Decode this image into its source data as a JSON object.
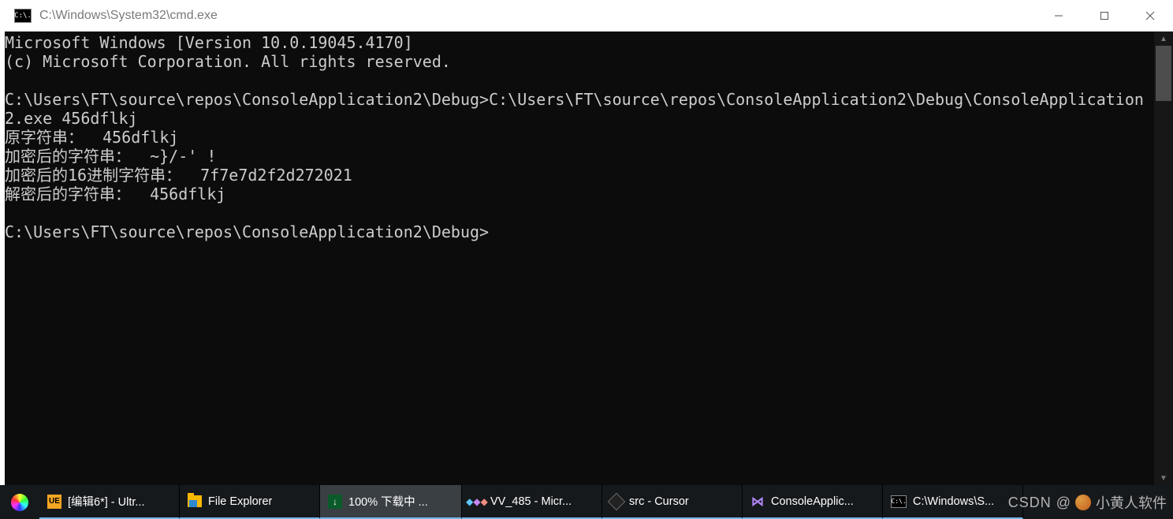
{
  "window": {
    "title": "C:\\Windows\\System32\\cmd.exe",
    "icon_label": "C:\\."
  },
  "console": {
    "lines": [
      "Microsoft Windows [Version 10.0.19045.4170]",
      "(c) Microsoft Corporation. All rights reserved.",
      "",
      "C:\\Users\\FT\\source\\repos\\ConsoleApplication2\\Debug>C:\\Users\\FT\\source\\repos\\ConsoleApplication2\\Debug\\ConsoleApplication2.exe 456dflkj",
      "原字符串：  456dflkj",
      "加密后的字符串：  ~}/-' !",
      "加密后的16进制字符串：  7f7e7d2f2d272021",
      "解密后的字符串：  456dflkj",
      "",
      "C:\\Users\\FT\\source\\repos\\ConsoleApplication2\\Debug>"
    ]
  },
  "taskbar": {
    "items": [
      {
        "id": "start",
        "label": "",
        "icon": "rainbow"
      },
      {
        "id": "ultraedit",
        "label": "[编辑6*] - Ultr...",
        "icon": "ue"
      },
      {
        "id": "explorer",
        "label": "File Explorer",
        "icon": "folder"
      },
      {
        "id": "download",
        "label": "100% 下载中 ...",
        "icon": "download",
        "active": true
      },
      {
        "id": "vv485",
        "label": "VV_485 - Micr...",
        "icon": "vv"
      },
      {
        "id": "cursor",
        "label": "src - Cursor",
        "icon": "cursor"
      },
      {
        "id": "vs",
        "label": "ConsoleApplic...",
        "icon": "vs"
      },
      {
        "id": "cmd",
        "label": "C:\\Windows\\S...",
        "icon": "cmd"
      }
    ]
  },
  "watermark": {
    "brand": "CSDN",
    "at": "@",
    "author": "小黄人软件"
  }
}
